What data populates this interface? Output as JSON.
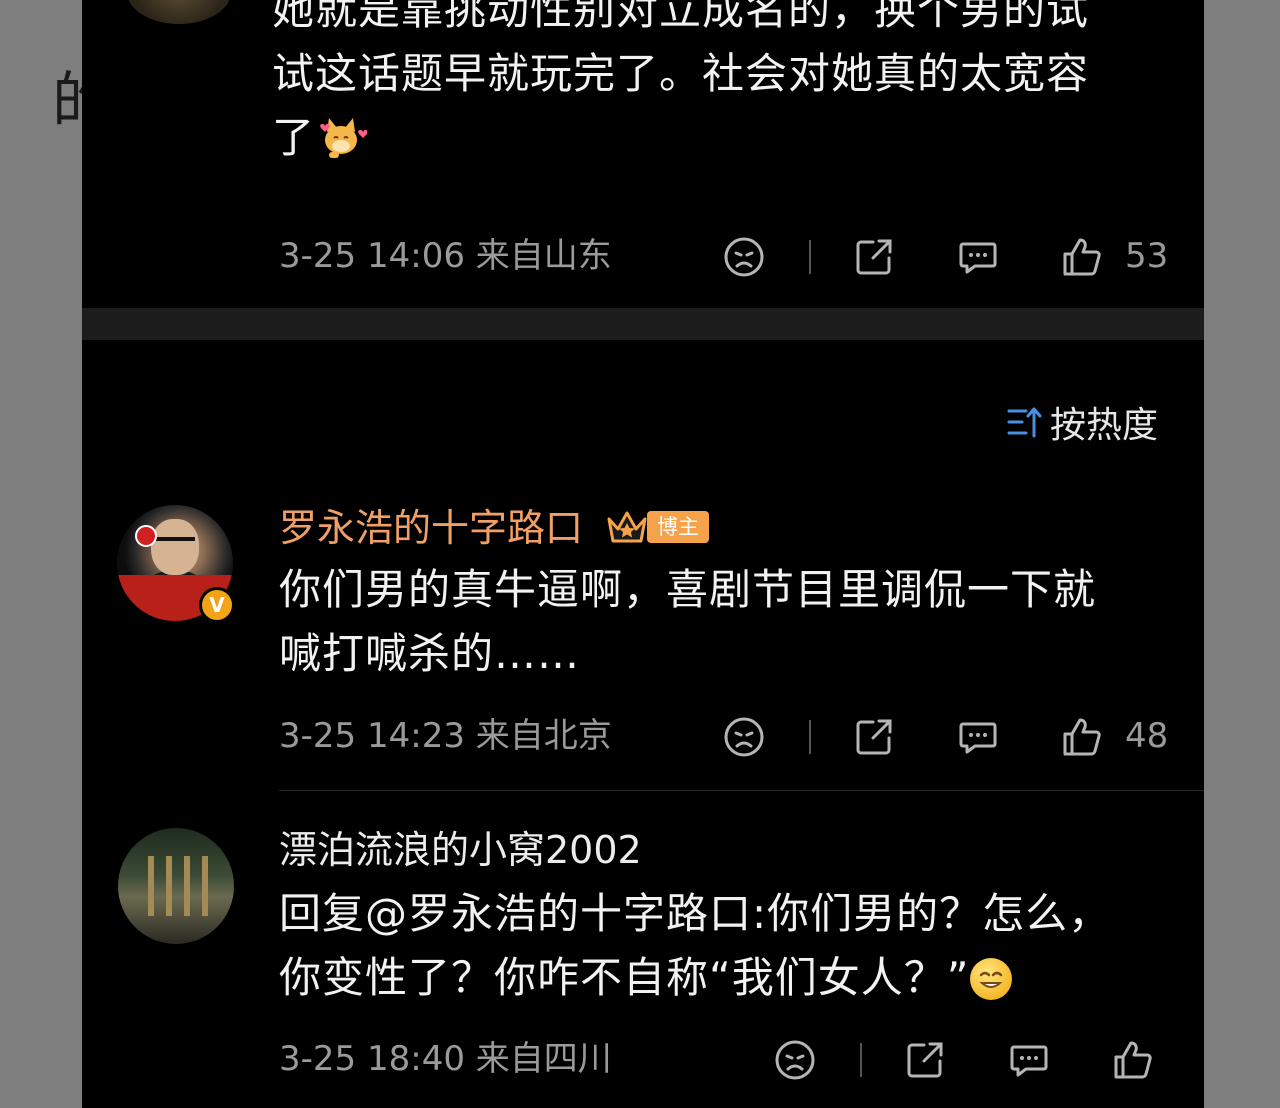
{
  "background": {
    "left_glyph": "的"
  },
  "top_comment": {
    "text_line1": "她就是靠挑动性别对立成名的，换个男的试",
    "text_line2": "试这话题早就玩完了。社会对她真的太宽容",
    "text_line3": "了",
    "emoji": "cat-hearts-emoji",
    "meta": {
      "time": "3-25 14:06",
      "location": "来自山东",
      "likes": "53"
    }
  },
  "sort": {
    "label": "按热度",
    "icon": "sort-icon"
  },
  "comments": [
    {
      "username": "罗永浩的十字路口",
      "badge": "博主",
      "verified": "V",
      "avatar_caption": "罗永浩的十字路口",
      "text_line1": "你们男的真牛逼啊，喜剧节目里调侃一下就",
      "text_line2": "喊打喊杀的……",
      "meta": {
        "time": "3-25 14:23",
        "location": "来自北京",
        "likes": "48"
      }
    },
    {
      "username": "漂泊流浪的小窝2002",
      "text_line1": "回复@罗永浩的十字路口:你们男的？怎么，",
      "text_line2": "你变性了？你咋不自称“我们女人？”",
      "emoji": "grin-emoji",
      "meta": {
        "time": "3-25 18:40",
        "location": "来自四川",
        "likes": ""
      }
    }
  ],
  "colors": {
    "background": "#000000",
    "text": "#f2f2f2",
    "meta": "#9a9a9a",
    "username_highlight": "#f0a066",
    "badge": "#f6a24a"
  }
}
